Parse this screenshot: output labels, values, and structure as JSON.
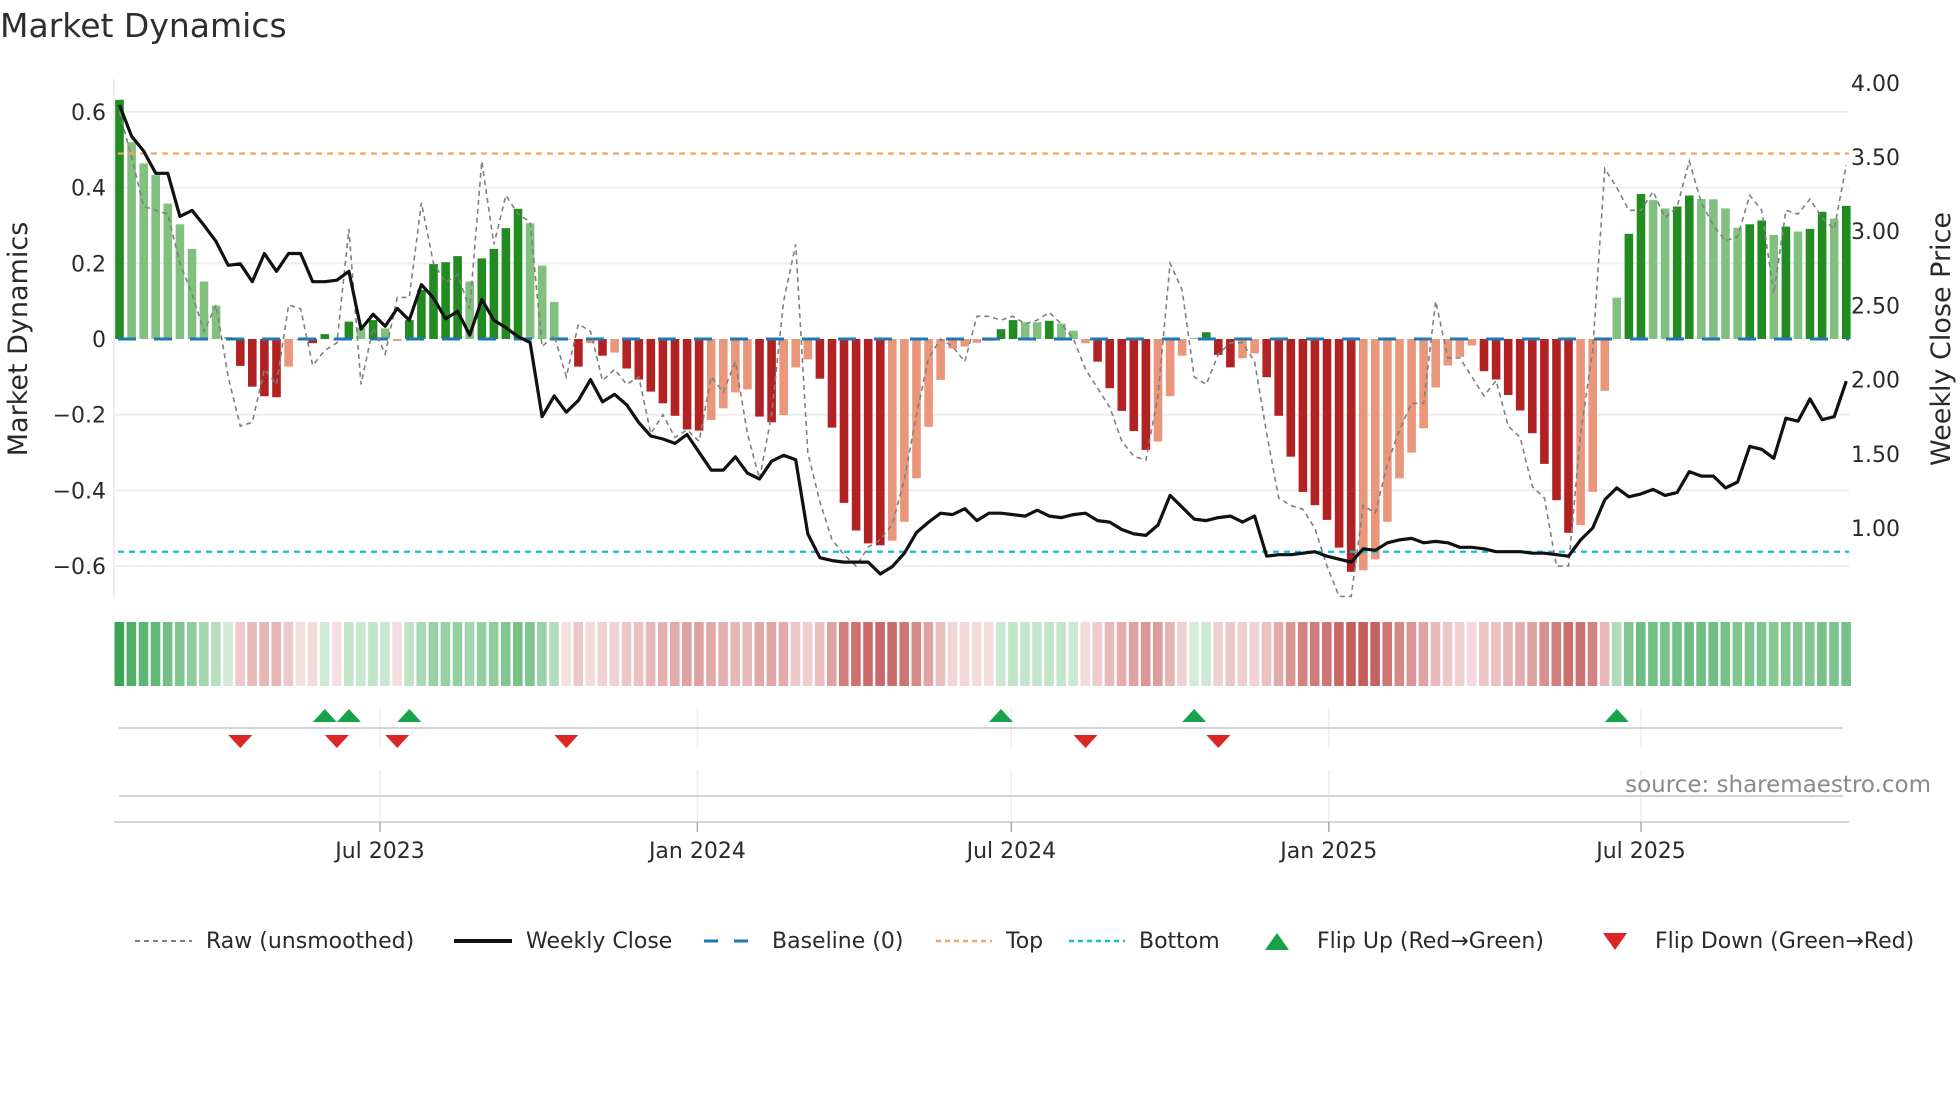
{
  "title": "Market Dynamics",
  "source": "source: sharemaestro.com",
  "legend": {
    "raw": "Raw (unsmoothed)",
    "close": "Weekly Close",
    "baseline": "Baseline (0)",
    "top": "Top",
    "bottom": "Bottom",
    "flip_up": "Flip Up (Red→Green)",
    "flip_down": "Flip Down (Green→Red)"
  },
  "chart_data": {
    "type": "bar",
    "title": "Market Dynamics",
    "x_start": "2023-01-31",
    "x_step_days": 7,
    "left_axis": {
      "label": "Market Dynamics",
      "range": [
        -0.687,
        0.687
      ],
      "ticks": [
        0.6,
        0.4,
        0.2,
        0,
        -0.2,
        -0.4,
        -0.6
      ],
      "tick_labels": [
        "0.6",
        "0.4",
        "0.2",
        "0",
        "−0.2",
        "−0.4",
        "−0.6"
      ]
    },
    "right_axis": {
      "label": "Weekly Close Price",
      "range": [
        0.52,
        4.03
      ],
      "ticks": [
        4.0,
        3.5,
        3.0,
        2.5,
        2.0,
        1.5,
        1.0
      ],
      "tick_labels": [
        "4.00",
        "3.50",
        "3.00",
        "2.50",
        "2.00",
        "1.50",
        "1.00"
      ]
    },
    "x_ticks": [
      {
        "date": "2023-07-01",
        "label": "Jul 2023"
      },
      {
        "date": "2024-01-01",
        "label": "Jan 2024"
      },
      {
        "date": "2024-07-01",
        "label": "Jul 2024"
      },
      {
        "date": "2025-01-01",
        "label": "Jan 2025"
      },
      {
        "date": "2025-07-01",
        "label": "Jul 2025"
      }
    ],
    "top": 0.49,
    "bottom": -0.562,
    "baseline": 0,
    "dynamics": [
      0.632,
      0.52,
      0.464,
      0.433,
      0.358,
      0.303,
      0.238,
      0.152,
      0.088,
      0.005,
      -0.071,
      -0.126,
      -0.151,
      -0.154,
      -0.073,
      -0.003,
      -0.011,
      0.013,
      -0.004,
      0.046,
      0.03,
      0.05,
      0.028,
      -0.005,
      0.05,
      0.13,
      0.198,
      0.203,
      0.219,
      0.152,
      0.213,
      0.238,
      0.293,
      0.344,
      0.306,
      0.194,
      0.098,
      -0.002,
      -0.073,
      -0.011,
      -0.044,
      -0.036,
      -0.078,
      -0.107,
      -0.139,
      -0.17,
      -0.203,
      -0.239,
      -0.242,
      -0.214,
      -0.183,
      -0.141,
      -0.133,
      -0.205,
      -0.22,
      -0.201,
      -0.075,
      -0.054,
      -0.105,
      -0.234,
      -0.433,
      -0.506,
      -0.54,
      -0.545,
      -0.533,
      -0.483,
      -0.368,
      -0.232,
      -0.108,
      -0.025,
      -0.02,
      -0.01,
      -0.005,
      0.026,
      0.05,
      0.044,
      0.044,
      0.048,
      0.041,
      0.022,
      -0.011,
      -0.06,
      -0.13,
      -0.19,
      -0.243,
      -0.293,
      -0.271,
      -0.151,
      -0.044,
      0.003,
      0.018,
      -0.042,
      -0.075,
      -0.051,
      -0.038,
      -0.101,
      -0.203,
      -0.311,
      -0.404,
      -0.439,
      -0.478,
      -0.551,
      -0.615,
      -0.611,
      -0.582,
      -0.483,
      -0.368,
      -0.3,
      -0.236,
      -0.128,
      -0.07,
      -0.047,
      -0.017,
      -0.085,
      -0.107,
      -0.148,
      -0.189,
      -0.249,
      -0.33,
      -0.426,
      -0.512,
      -0.492,
      -0.404,
      -0.137,
      0.109,
      0.278,
      0.383,
      0.367,
      0.345,
      0.35,
      0.379,
      0.37,
      0.369,
      0.345,
      0.294,
      0.303,
      0.313,
      0.275,
      0.297,
      0.284,
      0.291,
      0.336,
      0.318,
      0.352
    ],
    "raw": [
      0.6,
      0.48,
      0.35,
      0.34,
      0.33,
      0.2,
      0.12,
      0.02,
      0.09,
      -0.1,
      -0.23,
      -0.22,
      -0.08,
      -0.12,
      0.09,
      0.08,
      -0.07,
      -0.03,
      -0.01,
      0.29,
      -0.12,
      0.03,
      -0.04,
      0.11,
      0.11,
      0.36,
      0.2,
      0.15,
      0.17,
      0.08,
      0.47,
      0.25,
      0.38,
      0.33,
      0.31,
      -0.02,
      0.01,
      -0.1,
      0.04,
      0.02,
      -0.11,
      -0.08,
      -0.12,
      -0.1,
      -0.25,
      -0.2,
      -0.26,
      -0.24,
      -0.27,
      -0.1,
      -0.14,
      -0.06,
      -0.25,
      -0.37,
      -0.2,
      0.1,
      0.25,
      -0.3,
      -0.43,
      -0.53,
      -0.57,
      -0.6,
      -0.55,
      -0.53,
      -0.49,
      -0.37,
      -0.2,
      -0.05,
      0.0,
      -0.02,
      -0.06,
      0.06,
      0.06,
      0.05,
      0.06,
      0.04,
      0.05,
      0.07,
      0.04,
      0.0,
      -0.08,
      -0.13,
      -0.18,
      -0.27,
      -0.31,
      -0.32,
      -0.15,
      0.2,
      0.13,
      -0.1,
      -0.12,
      -0.04,
      -0.01,
      -0.01,
      -0.06,
      -0.25,
      -0.42,
      -0.44,
      -0.45,
      -0.5,
      -0.6,
      -0.68,
      -0.68,
      -0.44,
      -0.46,
      -0.33,
      -0.24,
      -0.17,
      -0.17,
      0.1,
      -0.05,
      -0.05,
      -0.1,
      -0.15,
      -0.11,
      -0.23,
      -0.26,
      -0.39,
      -0.42,
      -0.6,
      -0.6,
      -0.25,
      -0.03,
      0.45,
      0.4,
      0.34,
      0.34,
      0.39,
      0.32,
      0.35,
      0.47,
      0.36,
      0.3,
      0.26,
      0.27,
      0.38,
      0.34,
      0.12,
      0.34,
      0.33,
      0.37,
      0.32,
      0.29,
      0.46
    ],
    "weekly_close": [
      3.85,
      3.64,
      3.54,
      3.39,
      3.39,
      3.1,
      3.14,
      3.04,
      2.93,
      2.77,
      2.78,
      2.66,
      2.85,
      2.73,
      2.85,
      2.85,
      2.66,
      2.66,
      2.67,
      2.73,
      2.34,
      2.44,
      2.36,
      2.48,
      2.4,
      2.64,
      2.55,
      2.41,
      2.46,
      2.3,
      2.54,
      2.4,
      2.35,
      2.29,
      2.25,
      1.75,
      1.89,
      1.78,
      1.86,
      2.0,
      1.85,
      1.9,
      1.83,
      1.71,
      1.62,
      1.6,
      1.57,
      1.63,
      1.51,
      1.39,
      1.39,
      1.48,
      1.37,
      1.33,
      1.45,
      1.49,
      1.46,
      0.96,
      0.8,
      0.78,
      0.77,
      0.77,
      0.77,
      0.69,
      0.74,
      0.83,
      0.97,
      1.04,
      1.1,
      1.09,
      1.13,
      1.05,
      1.1,
      1.1,
      1.09,
      1.08,
      1.12,
      1.08,
      1.07,
      1.09,
      1.1,
      1.05,
      1.04,
      0.99,
      0.96,
      0.95,
      1.02,
      1.22,
      1.14,
      1.06,
      1.05,
      1.07,
      1.08,
      1.04,
      1.08,
      0.81,
      0.82,
      0.82,
      0.83,
      0.84,
      0.81,
      0.79,
      0.77,
      0.86,
      0.85,
      0.9,
      0.92,
      0.93,
      0.9,
      0.91,
      0.9,
      0.87,
      0.87,
      0.86,
      0.84,
      0.84,
      0.84,
      0.83,
      0.83,
      0.82,
      0.81,
      0.92,
      1.0,
      1.19,
      1.27,
      1.21,
      1.23,
      1.26,
      1.22,
      1.24,
      1.38,
      1.35,
      1.35,
      1.27,
      1.31,
      1.55,
      1.53,
      1.47,
      1.74,
      1.72,
      1.87,
      1.73,
      1.75,
      1.99
    ],
    "colors": {
      "green_strong": "#228b22",
      "green_weak": "#81c07f",
      "red_strong": "#b22222",
      "red_weak": "#e9967a",
      "raw": "#808080",
      "close": "#111111",
      "baseline": "#1f77b4",
      "top": "#f4a460",
      "bottom": "#17becf",
      "flip_up": "#16a34a",
      "flip_down": "#dc2626"
    }
  }
}
